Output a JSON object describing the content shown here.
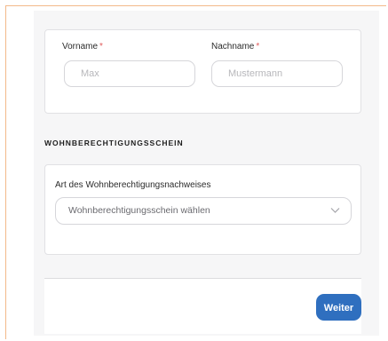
{
  "name_card": {
    "first_name": {
      "label": "Vorname",
      "required_marker": "*",
      "placeholder": "Max"
    },
    "last_name": {
      "label": "Nachname",
      "required_marker": "*",
      "placeholder": "Mustermann"
    }
  },
  "section": {
    "title": "WOHNBERECHTIGUNGSSCHEIN"
  },
  "wbs_card": {
    "label": "Art des Wohnberechtigungsnachweises",
    "select_placeholder": "Wohnberechtigungsschein wählen"
  },
  "footer": {
    "next_label": "Weiter"
  },
  "colors": {
    "accent": "#2f6fbf",
    "required": "#e05b5b",
    "frame": "#f3b98a"
  },
  "icons": {
    "select_indicator": "chevron-down-icon"
  }
}
